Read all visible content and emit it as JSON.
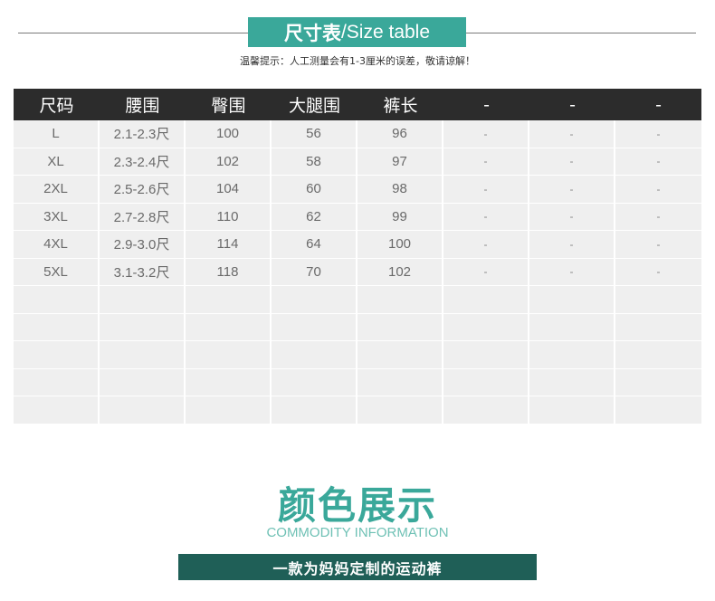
{
  "header": {
    "title_cn": "尺寸表",
    "title_en": "/Size table",
    "tip": "温馨提示：人工测量会有1-3厘米的误差，敬请谅解！"
  },
  "size_table": {
    "columns": [
      "尺码",
      "腰围",
      "臀围",
      "大腿围",
      "裤长",
      "-",
      "-",
      "-"
    ],
    "rows": [
      [
        "L",
        "2.1-2.3尺",
        "100",
        "56",
        "96",
        "-",
        "-",
        "-"
      ],
      [
        "XL",
        "2.3-2.4尺",
        "102",
        "58",
        "97",
        "-",
        "-",
        "-"
      ],
      [
        "2XL",
        "2.5-2.6尺",
        "104",
        "60",
        "98",
        "-",
        "-",
        "-"
      ],
      [
        "3XL",
        "2.7-2.8尺",
        "110",
        "62",
        "99",
        "-",
        "-",
        "-"
      ],
      [
        "4XL",
        "2.9-3.0尺",
        "114",
        "64",
        "100",
        "-",
        "-",
        "-"
      ],
      [
        "5XL",
        "3.1-3.2尺",
        "118",
        "70",
        "102",
        "-",
        "-",
        "-"
      ],
      [
        "",
        "",
        "",
        "",
        "",
        "",
        "",
        ""
      ],
      [
        "",
        "",
        "",
        "",
        "",
        "",
        "",
        ""
      ],
      [
        "",
        "",
        "",
        "",
        "",
        "",
        "",
        ""
      ],
      [
        "",
        "",
        "",
        "",
        "",
        "",
        "",
        ""
      ],
      [
        "",
        "",
        "",
        "",
        "",
        "",
        "",
        ""
      ]
    ]
  },
  "color_section": {
    "title": "颜色展示",
    "subtitle": "COMMODITY INFORMATION",
    "banner": "一款为妈妈定制的运动裤"
  },
  "colors": {
    "accent": "#3aa89a",
    "header_bg": "#2c2c2c",
    "cell_bg": "#efefef",
    "banner_bg": "#1f5f57"
  }
}
